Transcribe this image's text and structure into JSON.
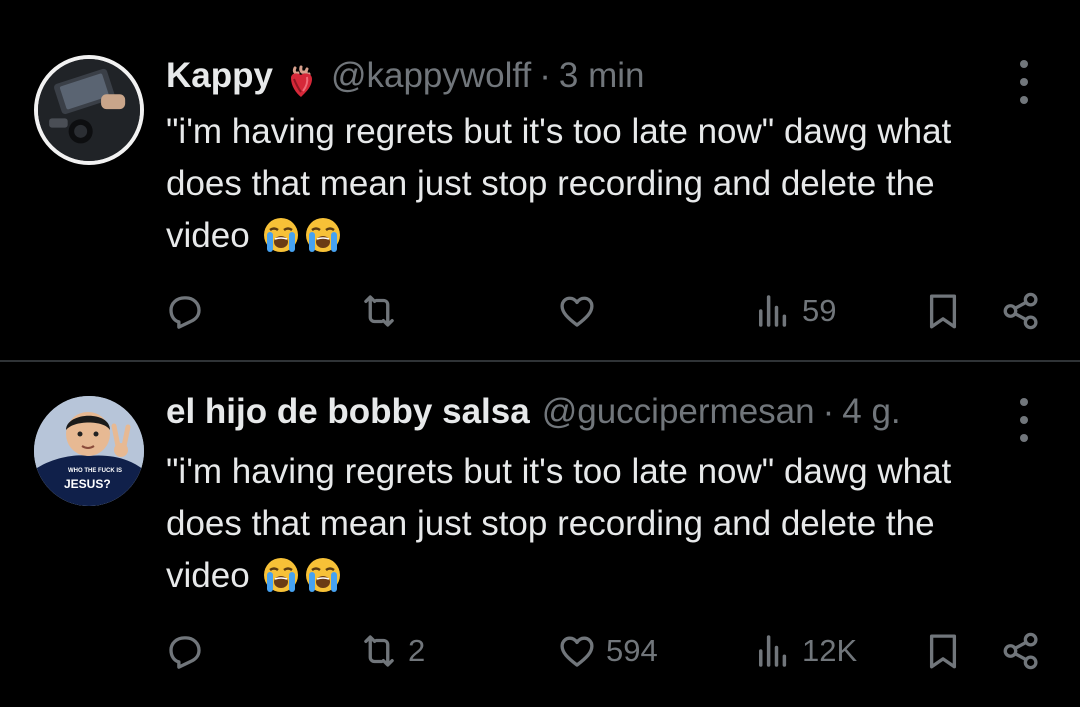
{
  "tweets": [
    {
      "name": "Kappy",
      "name_emoji": "anatomical-heart-emoji",
      "handle": "@kappywolff",
      "separator": "·",
      "time": "3 min",
      "text": "\"i'm having regrets but it's too late now\" dawg what does that mean just stop recording and delete the video",
      "emojis": [
        "loudly-crying-face-emoji",
        "loudly-crying-face-emoji"
      ],
      "replies": "",
      "reposts": "",
      "likes": "",
      "views": "59"
    },
    {
      "name": "el hijo de bobby salsa",
      "handle": "@guccipermesan",
      "separator": "·",
      "time": "4 g.",
      "text": "\"i'm having regrets but it's too late now\" dawg what does that mean just stop recording and delete the video",
      "emojis": [
        "loudly-crying-face-emoji",
        "loudly-crying-face-emoji"
      ],
      "avatar_text": [
        "WHO THE FUCK IS",
        "JESUS?"
      ],
      "replies": "",
      "reposts": "2",
      "likes": "594",
      "views": "12K"
    }
  ],
  "icons": {
    "reply": "reply-icon",
    "repost": "repost-icon",
    "like": "heart-icon",
    "views": "views-icon",
    "bookmark": "bookmark-icon",
    "share": "share-icon",
    "more": "more-options-icon"
  },
  "colors": {
    "background": "#000000",
    "text": "#e7e9ea",
    "muted": "#71767b",
    "divider": "#2f3336"
  }
}
